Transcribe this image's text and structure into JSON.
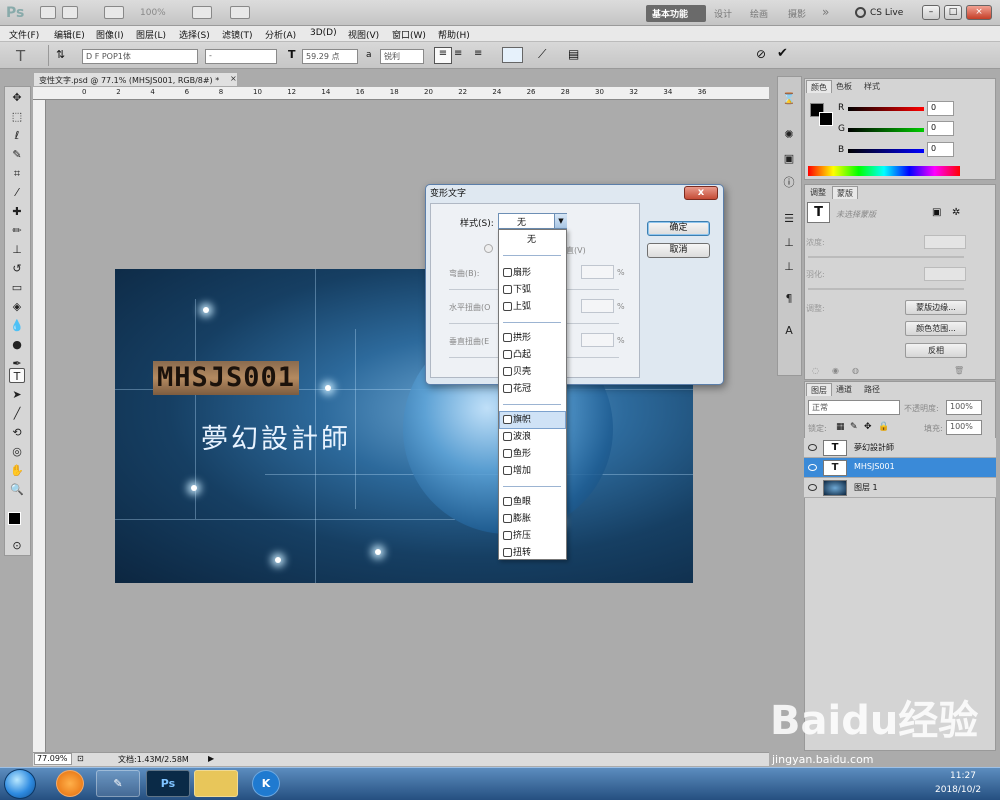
{
  "titlebar": {
    "logo": "Ps",
    "zoom": "100%",
    "workspaces": [
      "基本功能",
      "设计",
      "绘画",
      "摄影"
    ],
    "more": "»",
    "cslive": "CS Live"
  },
  "menu": [
    "文件(F)",
    "编辑(E)",
    "图像(I)",
    "图层(L)",
    "选择(S)",
    "滤镜(T)",
    "分析(A)",
    "3D(D)",
    "视图(V)",
    "窗口(W)",
    "帮助(H)"
  ],
  "options": {
    "font_family": "D F POP1体",
    "font_style": "-",
    "font_size": "59.29 点",
    "aa_label": "a",
    "antialias": "锐利"
  },
  "document": {
    "tab_title": "变性文字.psd @ 77.1% (MHSJS001, RGB/8#) *",
    "close": "×",
    "zoom": "77.09%",
    "doc_size": "文档:1.43M/2.58M"
  },
  "ruler_numbers": [
    "0",
    "2",
    "4",
    "6",
    "8",
    "10",
    "12",
    "14",
    "16",
    "18",
    "20",
    "22",
    "24",
    "26",
    "28",
    "30",
    "32",
    "34",
    "36"
  ],
  "image": {
    "text1": "MHSJS001",
    "text2": "夢幻設計師"
  },
  "dialog": {
    "title": "变形文字",
    "close": "x",
    "style_label": "样式(S):",
    "style_value": "无",
    "ok": "确定",
    "cancel": "取消",
    "orient_h": "(H)",
    "orient_v": "直(V)",
    "bend": "弯曲(B):",
    "hdist": "水平扭曲(O",
    "vdist": "垂直扭曲(E",
    "pct": "%",
    "options": [
      "无",
      "扇形",
      "下弧",
      "上弧",
      "拱形",
      "凸起",
      "贝壳",
      "花冠",
      "旗帜",
      "波浪",
      "鱼形",
      "增加",
      "鱼眼",
      "膨胀",
      "挤压",
      "扭转"
    ],
    "selected": "旗帜"
  },
  "color_panel": {
    "tabs": [
      "颜色",
      "色板",
      "样式"
    ],
    "r_label": "R",
    "r_value": "0",
    "g_label": "G",
    "g_value": "0",
    "b_label": "B",
    "b_value": "0"
  },
  "adjust_panel": {
    "tabs": [
      "调整",
      "蒙版"
    ],
    "hint": "未选择蒙版",
    "density": "浓度:",
    "feather": "羽化:",
    "refine": "调整:",
    "btn_edge": "蒙版边缘...",
    "btn_range": "颜色范围...",
    "btn_invert": "反相"
  },
  "layers_panel": {
    "tabs": [
      "图层",
      "通道",
      "路径"
    ],
    "blend_mode": "正常",
    "opacity_label": "不透明度:",
    "opacity": "100%",
    "lock_label": "锁定:",
    "fill_label": "填充:",
    "fill": "100%",
    "layers": [
      {
        "name": "夢幻設計師",
        "type": "T"
      },
      {
        "name": "MHSJS001",
        "type": "T"
      },
      {
        "name": "图层 1",
        "type": "img"
      }
    ],
    "selected_layer": "MHSJS001"
  },
  "taskbar": {
    "apps": [
      "Ps",
      "K"
    ],
    "time": "11:27",
    "date": "2018/10/2"
  },
  "watermark": {
    "text": "Baidu经验",
    "sub": "jingyan.baidu.com"
  }
}
